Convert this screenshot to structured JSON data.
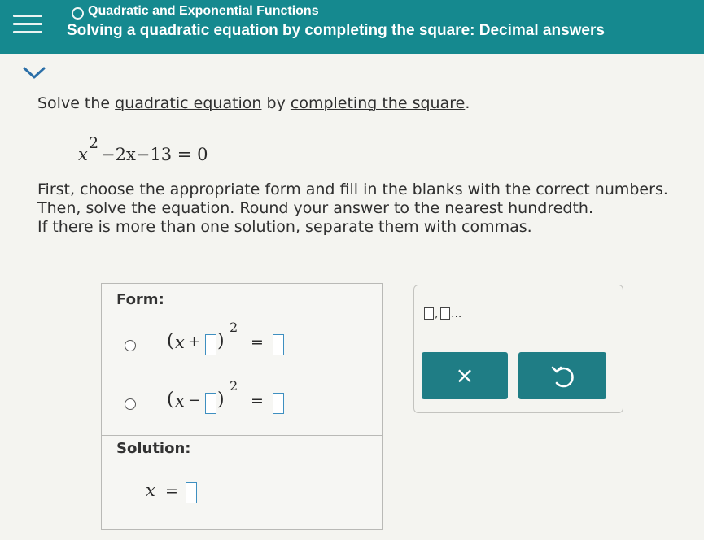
{
  "header": {
    "topic": "Quadratic and Exponential Functions",
    "title": "Solving a quadratic equation by completing the square: Decimal answers"
  },
  "problem": {
    "prompt_start": "Solve the ",
    "link_quadratic": "quadratic equation",
    "prompt_mid": " by ",
    "link_completing": "completing the square",
    "prompt_end": ".",
    "equation": {
      "variable": "x",
      "exponent": "2",
      "rest": "−2x−13 = 0"
    },
    "instructions": [
      "First, choose the appropriate form and fill in the blanks with the correct numbers.",
      "Then, solve the equation. Round your answer to the nearest hundredth.",
      "If there is more than one solution, separate them with commas."
    ]
  },
  "answer_panel": {
    "form_label": "Form:",
    "option_plus": {
      "open": "(",
      "var": "x",
      "op": "+",
      "exponent": "2",
      "equals": "="
    },
    "option_minus": {
      "open": "(",
      "var": "x",
      "op": "−",
      "exponent": "2",
      "equals": "="
    },
    "solution_label": "Solution:",
    "solution": {
      "var": "x",
      "equals": "="
    }
  },
  "toolbox": {
    "comma_sep": ",",
    "ellipsis": "...",
    "clear_symbol": "×"
  },
  "icons": [
    "menu-icon",
    "chevron-down-icon",
    "undo-icon"
  ],
  "colors": {
    "header_bg": "#15898f",
    "button_bg": "#1f7d85",
    "input_border": "#3e8fc0"
  }
}
